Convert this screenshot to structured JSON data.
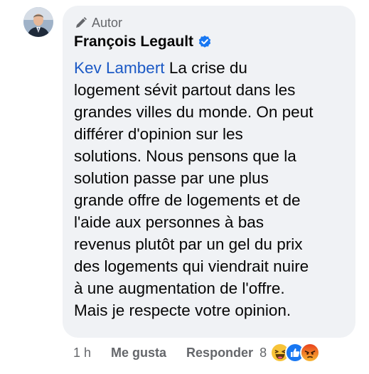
{
  "comment": {
    "badge": "Autor",
    "author_name": "François Legault",
    "mention": "Kev Lambert",
    "text_lines": [
      " La crise du",
      "logement sévit partout dans les",
      "grandes villes du monde. On peut",
      "différer d'opinion sur les",
      "solutions. Nous pensons que la",
      "solution passe par une plus",
      "grande offre de logements et de",
      "l'aide aux personnes à bas",
      "revenus plutôt par un gel du prix",
      "des logements qui viendrait nuire",
      "à une augmentation de l'offre.",
      "Mais je respecte votre opinion."
    ]
  },
  "actions": {
    "time": "1 h",
    "like_label": "Me gusta",
    "reply_label": "Responder",
    "reaction_count": "8"
  },
  "reactions": [
    "haha-icon",
    "like-icon",
    "angry-icon"
  ],
  "colors": {
    "bubble": "#f0f2f5",
    "mention": "#1b59c5",
    "verified": "#1877f2",
    "secondary_text": "#65676b"
  }
}
